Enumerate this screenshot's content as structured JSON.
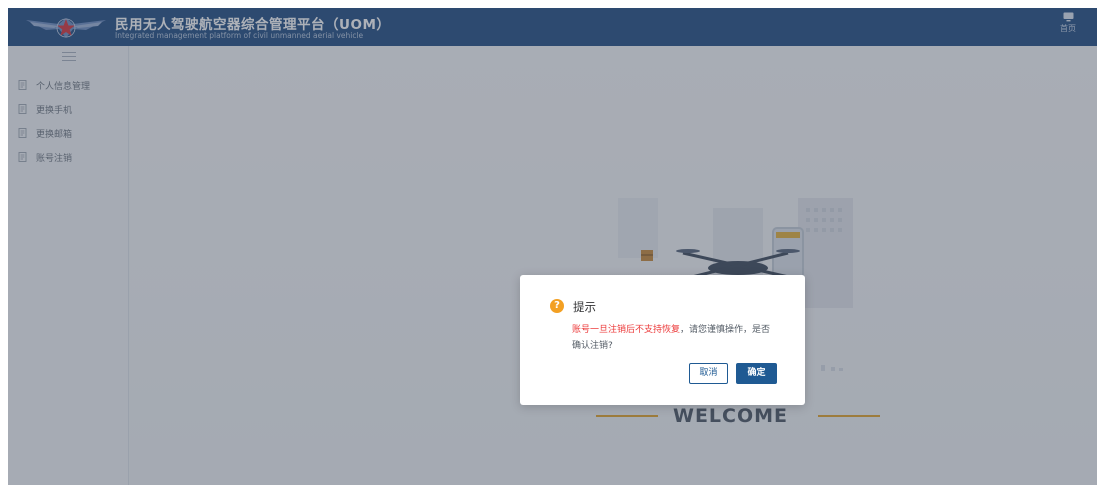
{
  "header": {
    "title": "民用无人驾驶航空器综合管理平台（UOM）",
    "subtitle": "Integrated management platform of civil unmanned aerial vehicle",
    "home_label": "首页"
  },
  "sidebar": {
    "items": [
      {
        "label": "个人信息管理",
        "icon": "document-icon"
      },
      {
        "label": "更换手机",
        "icon": "document-icon"
      },
      {
        "label": "更换邮箱",
        "icon": "document-icon"
      },
      {
        "label": "账号注销",
        "icon": "document-icon"
      }
    ]
  },
  "main": {
    "welcome_text": "WELCOME"
  },
  "dialog": {
    "title": "提示",
    "icon": "question-icon",
    "message_warning": "账号一旦注销后不支持恢复",
    "message_rest": "，请您谨慎操作，是否确认注销?",
    "cancel_label": "取消",
    "confirm_label": "确定"
  },
  "colors": {
    "header_bg": "#244e84",
    "primary": "#1f5a93",
    "warning_text": "#ec3a3a",
    "dialog_icon": "#f3a023",
    "accent_line": "#e3a42c"
  }
}
